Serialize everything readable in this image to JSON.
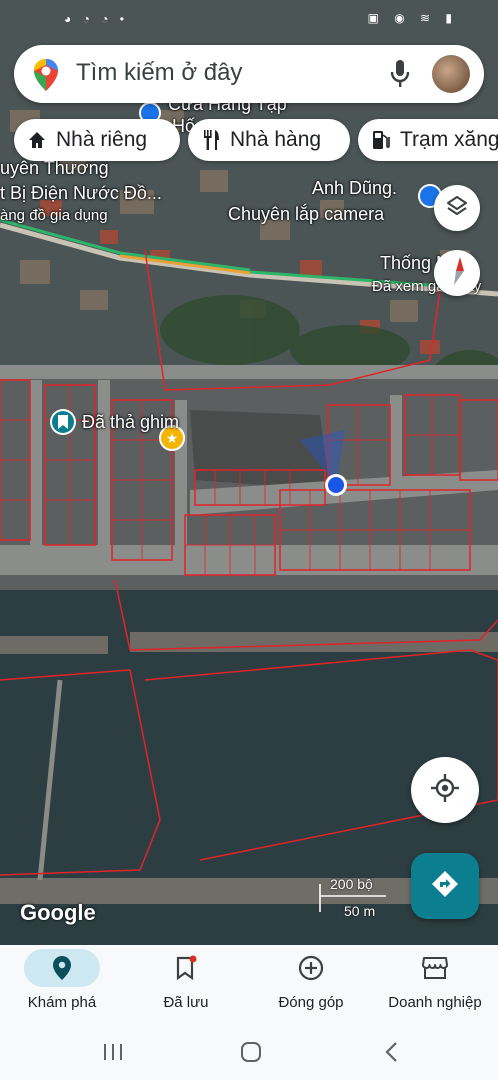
{
  "status_bar": {
    "left_icons": "◕ ◔ ◔ •",
    "right_icons": "▣ ◉ ≋ ▮"
  },
  "search": {
    "placeholder": "Tìm kiếm ở đây"
  },
  "chips": [
    {
      "label": "Nhà riêng",
      "icon": "home-icon"
    },
    {
      "label": "Nhà hàng",
      "icon": "restaurant-icon"
    },
    {
      "label": "Trạm xăng",
      "icon": "gas-station-icon"
    }
  ],
  "map_labels": {
    "shop_top": "Cửa Hàng Tạp",
    "shop_top_line2": "Hố",
    "store_left_1": "uyên Thương",
    "store_left_2": "t Bị Điện Nước Đồ...",
    "store_left_3": "àng đồ gia dụng",
    "camera_name": "Anh Dũng.",
    "camera_desc": "Chuyên lắp camera",
    "place_right": "Thống Nhất",
    "place_right_sub": "Đã xem gần đây",
    "dropped_pin": "Đã thả ghim"
  },
  "scale": {
    "feet": "200 bộ",
    "meters": "50 m"
  },
  "logo": "Google",
  "bottom_nav": [
    {
      "label": "Khám phá",
      "icon": "explore-pin-icon",
      "active": true
    },
    {
      "label": "Đã lưu",
      "icon": "bookmark-icon",
      "active": false
    },
    {
      "label": "Đóng góp",
      "icon": "add-circle-icon",
      "active": false
    },
    {
      "label": "Doanh nghiệp",
      "icon": "storefront-icon",
      "active": false
    }
  ],
  "colors": {
    "accent": "#0b7f8f",
    "parcel_line": "#e0242a",
    "location_dot": "#1a56e8"
  }
}
